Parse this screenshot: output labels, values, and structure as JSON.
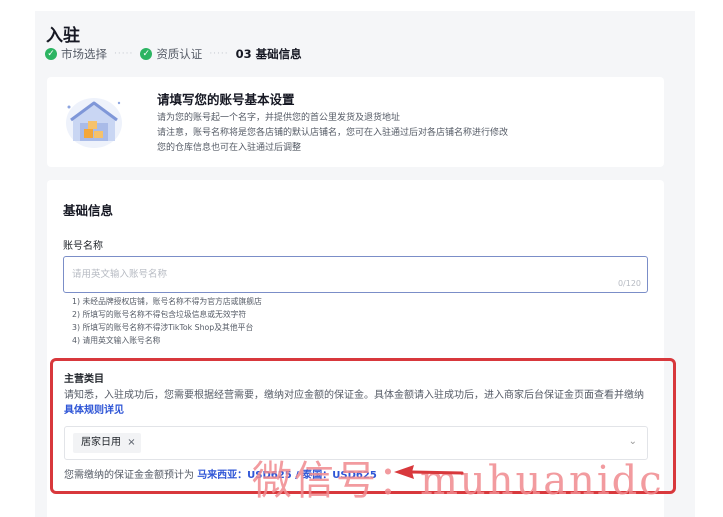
{
  "page": {
    "title": "入驻",
    "steps": [
      {
        "label": "市场选择",
        "status": "done"
      },
      {
        "label": "资质认证",
        "status": "done"
      },
      {
        "label": "03 基础信息",
        "status": "current"
      }
    ]
  },
  "intro": {
    "title": "请填写您的账号基本设置",
    "lines": [
      "请为您的账号起一个名字，并提供您的首公里发货及退货地址",
      "请注意，账号名称将是您各店铺的默认店铺名，您可在入驻通过后对各店铺名称进行修改",
      "您的仓库信息也可在入驻通过后调整"
    ]
  },
  "basic": {
    "section_title": "基础信息",
    "account_label": "账号名称",
    "account_placeholder": "请用英文输入账号名称",
    "account_value": "",
    "counter": "0/120",
    "hints": [
      "1) 未经品牌授权店铺，账号名称不得为官方店或旗舰店",
      "2) 所填写的账号名称不得包含垃圾信息或无效字符",
      "3) 所填写的账号名称不得涉TikTok Shop及其他平台",
      "4) 请用英文输入账号名称"
    ]
  },
  "category": {
    "label": "主营类目",
    "desc": "请知悉，入驻成功后，您需要根据经营需要，缴纳对应金额的保证金。具体金额请入驻成功后，进入商家后台保证金页面查看并缴纳",
    "rule_link": "具体规则详见",
    "selected_tag": "居家日用",
    "remove_icon": "×",
    "dropdown_icon": "⌄",
    "deposit_prefix": "您需缴纳的保证金金额预计为",
    "deposit_value": "马来西亚：USD625 / 泰国：USD625"
  },
  "overlay": {
    "watermark": "微信号：muhuanidc"
  },
  "colors": {
    "accent": "#2e55d6",
    "success": "#2cb462",
    "highlight": "#d8383c",
    "watermark": "#f08a8f"
  }
}
